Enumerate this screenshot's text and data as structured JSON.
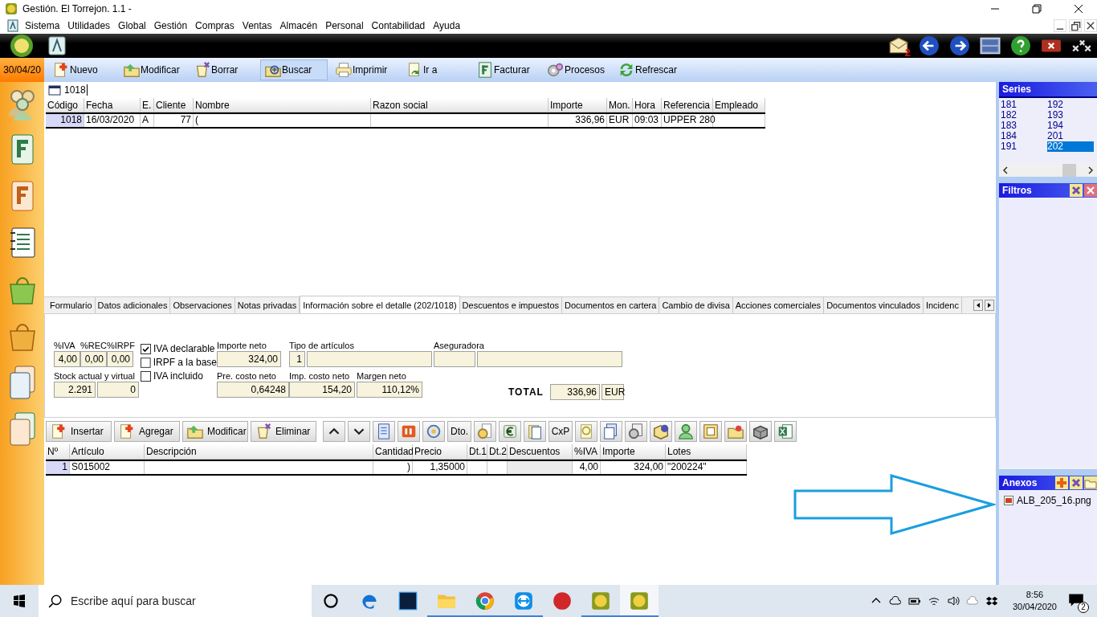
{
  "window": {
    "title": "Gestión. El Torrejon. 1.1 -"
  },
  "menu": [
    "Sistema",
    "Utilidades",
    "Global",
    "Gestión",
    "Compras",
    "Ventas",
    "Almacén",
    "Personal",
    "Contabilidad",
    "Ayuda"
  ],
  "mail_badge": "2",
  "date": "30/04/20",
  "toolbar": [
    {
      "label": "Nuevo",
      "selected": false
    },
    {
      "label": "Modificar",
      "selected": false
    },
    {
      "label": "Borrar",
      "selected": false
    },
    {
      "label": "Buscar",
      "selected": true
    },
    {
      "label": "Imprimir",
      "selected": false
    },
    {
      "label": "Ir a",
      "selected": false
    },
    {
      "label": "Facturar",
      "selected": false
    },
    {
      "label": "Procesos",
      "selected": false
    },
    {
      "label": "Refrescar",
      "selected": false
    }
  ],
  "search": {
    "value": "1018"
  },
  "documents": {
    "columns": [
      "Código",
      "Fecha",
      "E.",
      "Cliente",
      "Nombre",
      "Razon social",
      "Importe",
      "Mon.",
      "Hora",
      "Referencia",
      "Empleado"
    ],
    "rows": [
      {
        "cells": [
          "1018",
          "16/03/2020",
          "A",
          "77",
          "(",
          null,
          "336,96",
          "EUR",
          "09:03",
          "UPPER 280",
          null
        ]
      }
    ]
  },
  "tabs": [
    {
      "label": "Formulario",
      "selected": false
    },
    {
      "label": "Datos adicionales",
      "selected": false
    },
    {
      "label": "Observaciones",
      "selected": false
    },
    {
      "label": "Notas privadas",
      "selected": false
    },
    {
      "label": "Información sobre el detalle (202/1018)",
      "selected": true
    },
    {
      "label": "Descuentos e impuestos",
      "selected": false
    },
    {
      "label": "Documentos en cartera",
      "selected": false
    },
    {
      "label": "Cambio de divisa",
      "selected": false
    },
    {
      "label": "Acciones comerciales",
      "selected": false
    },
    {
      "label": "Documentos vinculados",
      "selected": false
    },
    {
      "label": "Incidenc",
      "selected": false
    }
  ],
  "detail": {
    "taxes": [
      {
        "label": "%IVA",
        "value": "4,00"
      },
      {
        "label": "%REC",
        "value": "0,00"
      },
      {
        "label": "%IRPF",
        "value": "0,00"
      }
    ],
    "checks": [
      {
        "label": "IVA declarable",
        "checked": true
      },
      {
        "label": "IRPF a la base",
        "checked": false
      },
      {
        "label": "IVA incluido",
        "checked": false
      }
    ],
    "importe_neto": {
      "label": "Importe neto",
      "value": "324,00"
    },
    "tipo_articulos": {
      "label": "Tipo de artículos",
      "value": "1"
    },
    "aseguradora": {
      "label": "Aseguradora"
    },
    "stock": {
      "label": "Stock actual y virtual",
      "values": [
        "2.291",
        "0"
      ]
    },
    "pre_costo": {
      "label": "Pre. costo neto",
      "value": "0,64248"
    },
    "imp_costo": {
      "label": "Imp. costo neto",
      "value": "154,20"
    },
    "margen": {
      "label": "Margen neto",
      "value": "110,12%"
    },
    "total": {
      "label": "TOTAL",
      "value": "336,96",
      "currency": "EUR"
    }
  },
  "line_toolbar": {
    "buttons": [
      "Insertar",
      "Agregar",
      "Modificar",
      "Eliminar"
    ],
    "text_buttons": [
      "Dto.",
      "CxP"
    ]
  },
  "lines": {
    "columns": [
      "Nº",
      "Artículo",
      "Descripción",
      "Cantidad",
      "Precio",
      "Dt.1",
      "Dt.2",
      "Descuentos",
      "%IVA",
      "Importe",
      "Lotes"
    ],
    "rows": [
      {
        "cells": [
          "1",
          "S015002",
          null,
          ")",
          "1,35000",
          null,
          null,
          null,
          "4,00",
          "324,00",
          "\"200224\""
        ]
      }
    ]
  },
  "series": {
    "title": "Series",
    "items": [
      {
        "label": "181",
        "selected": false
      },
      {
        "label": "182",
        "selected": false
      },
      {
        "label": "183",
        "selected": false
      },
      {
        "label": "184",
        "selected": false
      },
      {
        "label": "191",
        "selected": false
      },
      {
        "label": "192",
        "selected": false
      },
      {
        "label": "193",
        "selected": false
      },
      {
        "label": "194",
        "selected": false
      },
      {
        "label": "201",
        "selected": false
      },
      {
        "label": "202",
        "selected": true
      }
    ]
  },
  "filters": {
    "title": "Filtros"
  },
  "attachments": {
    "title": "Anexos",
    "files": [
      "ALB_205_16.png"
    ]
  },
  "taskbar": {
    "search_placeholder": "Escribe aquí para buscar",
    "time": "8:56",
    "date": "30/04/2020",
    "notifications": "2"
  }
}
